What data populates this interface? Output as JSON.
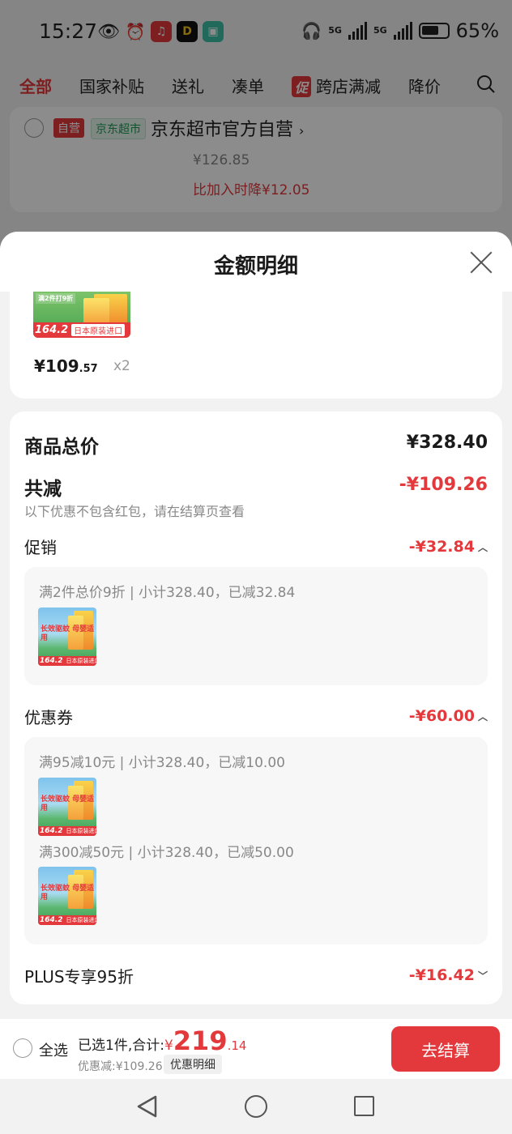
{
  "status_bar": {
    "time": "15:27",
    "signal_1": "5G",
    "signal_2": "5G",
    "battery": "65%"
  },
  "tabs": [
    "全部",
    "国家补贴",
    "送礼",
    "凑单",
    "跨店满减",
    "降价"
  ],
  "promo_badge": "促",
  "store": {
    "self_tag": "自营",
    "market_tag": "京东超市",
    "name": "京东超市官方自营",
    "price": "¥126.85",
    "drop_text": "比加入时降¥12.05"
  },
  "sheet": {
    "title": "金额明细"
  },
  "product": {
    "price_int": "¥109",
    "price_dec": ".57",
    "qty": "x2",
    "image_tag": "日本原装进口",
    "image_price": "164.2",
    "image_text": "长效驱蚊 母婴适用",
    "image_badge": "满2件打9折"
  },
  "summary": {
    "total_label": "商品总价",
    "total_value": "¥328.40",
    "reduce_label": "共减",
    "reduce_value": "-¥109.26",
    "reduce_hint": "以下优惠不包含红包，请在结算页查看",
    "promo": {
      "label": "促销",
      "value": "-¥32.84",
      "line": "满2件总价9折 | 小计328.40，已减32.84"
    },
    "coupon": {
      "label": "优惠券",
      "value": "-¥60.00",
      "line1": "满95减10元 | 小计328.40，已减10.00",
      "line2": "满300减50元 | 小计328.40，已减50.00"
    },
    "plus": {
      "label": "PLUS专享95折",
      "value": "-¥16.42"
    }
  },
  "bottom": {
    "select_all": "全选",
    "selected_text": "已选1件,合计:",
    "currency": "¥",
    "total_int": "219",
    "total_dec": ".14",
    "discount_text": "优惠减:¥109.26",
    "discount_button": "优惠明细",
    "checkout": "去结算"
  },
  "colors": {
    "accent": "#e4393c",
    "green": "#1d9a52"
  }
}
